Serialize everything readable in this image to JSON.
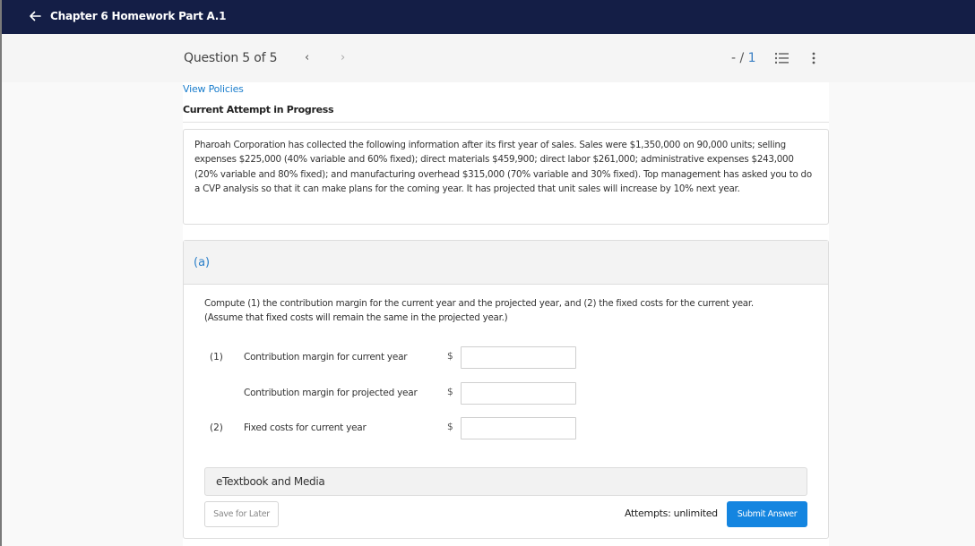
{
  "header": {
    "title": "Chapter 6 Homework Part A.1",
    "back_icon": "arrow-left-icon"
  },
  "question_bar": {
    "counter": "Question 5 of 5",
    "prev_icon": "‹",
    "next_icon": "›",
    "score_prefix": "- / ",
    "score_total": "1",
    "list_icon": "numbered-list-icon",
    "more_icon": "vertical-ellipsis-icon"
  },
  "policies_link": "View Policies",
  "attempt_status": "Current Attempt in Progress",
  "problem_text": "Pharoah Corporation has collected the following information after its first year of sales. Sales were $1,350,000 on 90,000 units; selling expenses $225,000 (40% variable and 60% fixed); direct materials $459,900; direct labor $261,000; administrative expenses $243,000 (20% variable and 80% fixed); and manufacturing overhead $315,000 (70% variable and 30% fixed). Top management has asked you to do a CVP analysis so that it can make plans for the coming year. It has projected that unit sales will increase by 10% next year.",
  "part": {
    "label": "(a)",
    "instructions_line1": "Compute (1) the contribution margin for the current year and the projected year, and (2) the fixed costs for the current year.",
    "instructions_line2": "(Assume that fixed costs will remain the same in the projected year.)",
    "rows": [
      {
        "num": "(1)",
        "label": "Contribution margin for current year",
        "currency": "$",
        "value": ""
      },
      {
        "num": "",
        "label": "Contribution margin for projected year",
        "currency": "$",
        "value": ""
      },
      {
        "num": "(2)",
        "label": "Fixed costs for current year",
        "currency": "$",
        "value": ""
      }
    ],
    "etextbook_label": "eTextbook and Media",
    "save_label": "Save for Later",
    "attempts_label": "Attempts: unlimited",
    "submit_label": "Submit Answer"
  },
  "colors": {
    "topbar": "#141e46",
    "accent_blue": "#1485e0",
    "link_blue": "#1a7dcc"
  }
}
